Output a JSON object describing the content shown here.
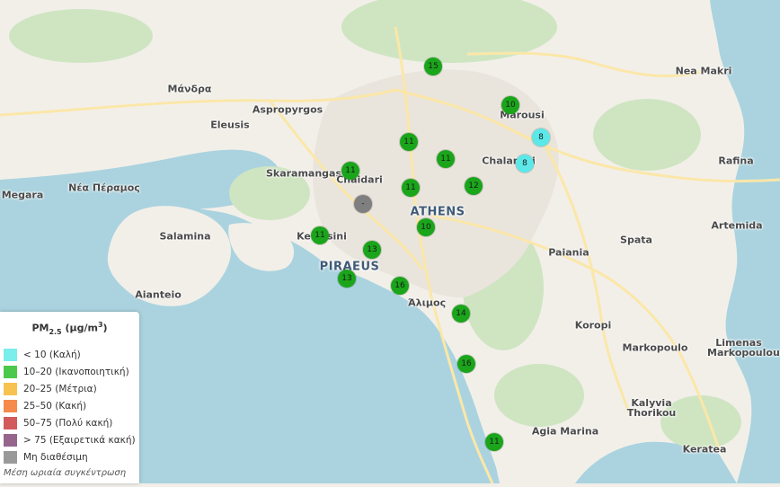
{
  "map": {
    "places": [
      {
        "name": "Μάνδρα",
        "kind": "town"
      },
      {
        "name": "Aspropyrgos",
        "kind": "town"
      },
      {
        "name": "Eleusis",
        "kind": "town"
      },
      {
        "name": "Skaramangas",
        "kind": "town"
      },
      {
        "name": "Chaidari",
        "kind": "town"
      },
      {
        "name": "Megara",
        "kind": "town"
      },
      {
        "name": "Νέα Πέραμος",
        "kind": "town"
      },
      {
        "name": "Salamina",
        "kind": "town"
      },
      {
        "name": "Keratsini",
        "kind": "town"
      },
      {
        "name": "PIRAEUS",
        "kind": "city"
      },
      {
        "name": "Aianteio",
        "kind": "town"
      },
      {
        "name": "ATHENS",
        "kind": "city"
      },
      {
        "name": "Marousi",
        "kind": "town"
      },
      {
        "name": "Chalandri",
        "kind": "town"
      },
      {
        "name": "Nea Makri",
        "kind": "town"
      },
      {
        "name": "Rafina",
        "kind": "town"
      },
      {
        "name": "Artemida",
        "kind": "town"
      },
      {
        "name": "Spata",
        "kind": "town"
      },
      {
        "name": "Paiania",
        "kind": "town"
      },
      {
        "name": "Άλιμος",
        "kind": "town"
      },
      {
        "name": "Koropi",
        "kind": "town"
      },
      {
        "name": "Markopoulo",
        "kind": "town"
      },
      {
        "name": "Limenas Markopoulou",
        "kind": "town"
      },
      {
        "name": "Kalyvia Thorikou",
        "kind": "town"
      },
      {
        "name": "Agia Marina",
        "kind": "town"
      },
      {
        "name": "Keratea",
        "kind": "town"
      }
    ],
    "stations": [
      {
        "value": "15",
        "category": "10-20"
      },
      {
        "value": "10",
        "category": "10-20"
      },
      {
        "value": "8",
        "category": "<10"
      },
      {
        "value": "8",
        "category": "<10"
      },
      {
        "value": "11",
        "category": "10-20"
      },
      {
        "value": "11",
        "category": "10-20"
      },
      {
        "value": "11",
        "category": "10-20"
      },
      {
        "value": "11",
        "category": "10-20"
      },
      {
        "value": "12",
        "category": "10-20"
      },
      {
        "value": "-",
        "category": "na"
      },
      {
        "value": "10",
        "category": "10-20"
      },
      {
        "value": "11",
        "category": "10-20"
      },
      {
        "value": "13",
        "category": "10-20"
      },
      {
        "value": "13",
        "category": "10-20"
      },
      {
        "value": "16",
        "category": "10-20"
      },
      {
        "value": "14",
        "category": "10-20"
      },
      {
        "value": "16",
        "category": "10-20"
      },
      {
        "value": "11",
        "category": "10-20"
      }
    ]
  },
  "legend": {
    "title_main": "PM",
    "title_sub": "2.5",
    "title_units_pre": " (µg/m",
    "title_sup": "3",
    "title_units_post": ")",
    "items": [
      {
        "key": "<10",
        "label": "< 10 (Καλή)",
        "color": "#7aeeea"
      },
      {
        "key": "10-20",
        "label": "10–20 (Ικανοποιητική)",
        "color": "#4cc94c"
      },
      {
        "key": "20-25",
        "label": "20–25 (Μέτρια)",
        "color": "#f7c24f"
      },
      {
        "key": "25-50",
        "label": "25–50 (Κακή)",
        "color": "#f58a4b"
      },
      {
        "key": "50-75",
        "label": "50–75 (Πολύ κακή)",
        "color": "#d35a5a"
      },
      {
        "key": ">75",
        "label": "> 75 (Εξαιρετικά κακή)",
        "color": "#96658c"
      },
      {
        "key": "na",
        "label": "Μη διαθέσιμη",
        "color": "#999999"
      }
    ],
    "note": "Μέση ωριαία συγκέντρωση"
  },
  "colors": {
    "sea": "#aad3df",
    "land": "#f2efe9",
    "green": "#cfe5c2",
    "urban": "#e9e4dc",
    "road": "#fbe7a8",
    "station_green": "#1aa51a",
    "station_cyan": "#5ce8e8",
    "station_gray": "#7f7f7f"
  }
}
